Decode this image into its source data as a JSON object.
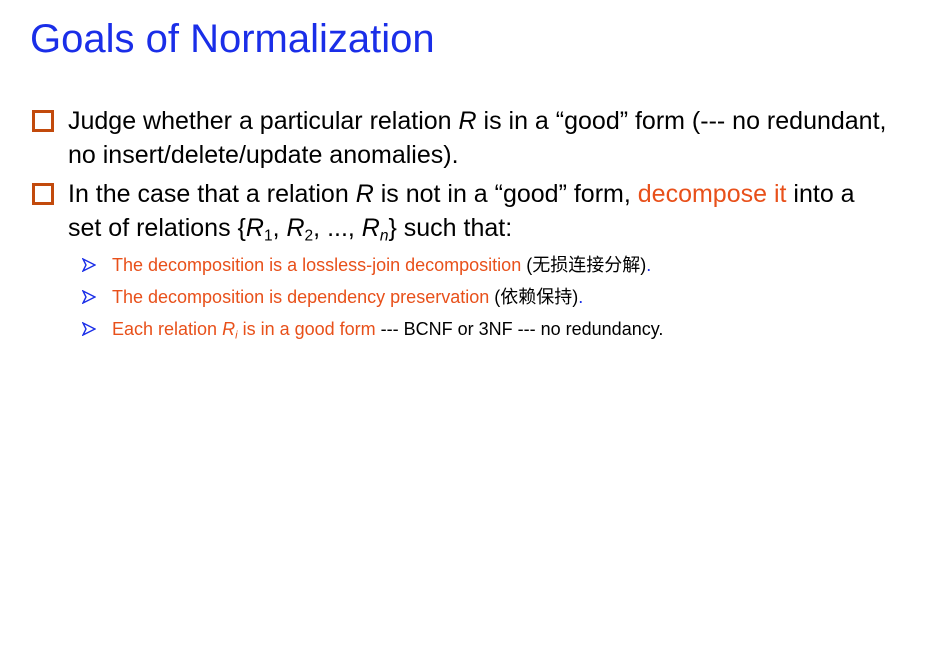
{
  "slide": {
    "title": "Goals of Normalization",
    "bullet1": {
      "t1": "Judge whether a particular relation ",
      "r": "R",
      "t2": " is in a “good” form (--- no redundant, no insert/delete/update anomalies)."
    },
    "bullet2": {
      "t1": "In the case that a relation ",
      "r": "R",
      "t2": " is not in a “good” form, ",
      "highlight": "decompose it",
      "t3": " into a set of relations {",
      "r1": "R",
      "s1": "1",
      "c1": ", ",
      "r2": "R",
      "s2": "2",
      "c2": ", ..., ",
      "rn": "R",
      "sn": "n",
      "t4": "} such that:"
    },
    "sub1": {
      "red": "The decomposition is a lossless-join decomposition",
      "open": " (",
      "cjk": "无损连接分解",
      "close": ")",
      "dot": "."
    },
    "sub2": {
      "red": "The decomposition is dependency preservation",
      "open": " (",
      "cjk": "依赖保持",
      "close": ")",
      "dot": "."
    },
    "sub3": {
      "red1": "Each relation ",
      "ri": "R",
      "si": "i",
      "red2": " is in a good form",
      "rest": " --- BCNF or 3NF --- no redundancy."
    }
  },
  "colors": {
    "title": "#1a2ee8",
    "highlight": "#e8501a",
    "bullet_box": "#c24a0c",
    "arrow": "#1a2ee8"
  },
  "icons": {
    "bullet": "hollow-square-bullet-icon",
    "sub_bullet": "arrowhead-bullet-icon"
  }
}
